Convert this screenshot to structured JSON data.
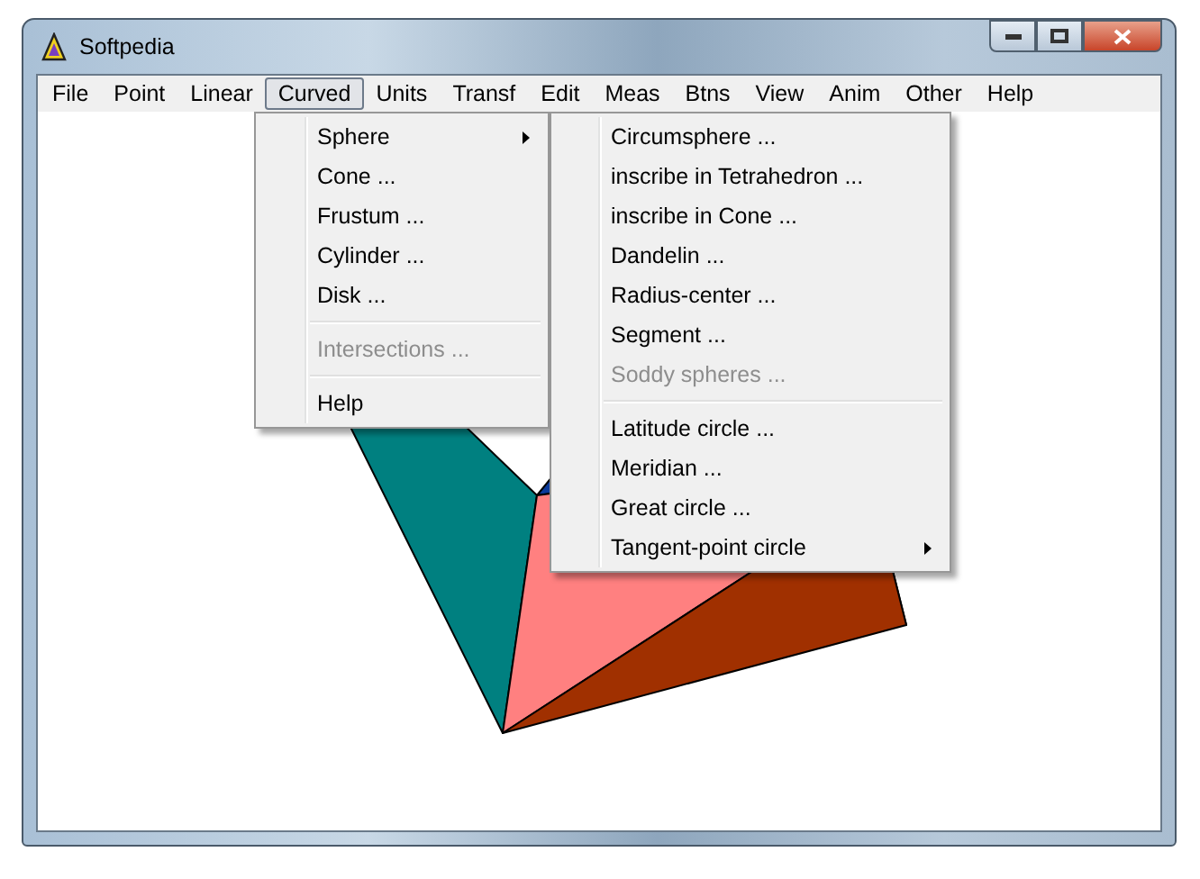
{
  "window": {
    "title": "Softpedia"
  },
  "menu_bar": [
    {
      "label": "File",
      "selected": false
    },
    {
      "label": "Point",
      "selected": false
    },
    {
      "label": "Linear",
      "selected": false
    },
    {
      "label": "Curved",
      "selected": true
    },
    {
      "label": "Units",
      "selected": false
    },
    {
      "label": "Transf",
      "selected": false
    },
    {
      "label": "Edit",
      "selected": false
    },
    {
      "label": "Meas",
      "selected": false
    },
    {
      "label": "Btns",
      "selected": false
    },
    {
      "label": "View",
      "selected": false
    },
    {
      "label": "Anim",
      "selected": false
    },
    {
      "label": "Other",
      "selected": false
    },
    {
      "label": "Help",
      "selected": false
    }
  ],
  "dropdown": [
    {
      "kind": "item",
      "label": "Sphere",
      "disabled": false,
      "submenu": true
    },
    {
      "kind": "item",
      "label": "Cone ...",
      "disabled": false,
      "submenu": false
    },
    {
      "kind": "item",
      "label": "Frustum ...",
      "disabled": false,
      "submenu": false
    },
    {
      "kind": "item",
      "label": "Cylinder ...",
      "disabled": false,
      "submenu": false
    },
    {
      "kind": "item",
      "label": "Disk ...",
      "disabled": false,
      "submenu": false
    },
    {
      "kind": "separator"
    },
    {
      "kind": "item",
      "label": "Intersections ...",
      "disabled": true,
      "submenu": false
    },
    {
      "kind": "separator"
    },
    {
      "kind": "item",
      "label": "Help",
      "disabled": false,
      "submenu": false
    }
  ],
  "submenu": [
    {
      "kind": "item",
      "label": "Circumsphere ...",
      "disabled": false,
      "submenu": false
    },
    {
      "kind": "item",
      "label": "inscribe in Tetrahedron ...",
      "disabled": false,
      "submenu": false
    },
    {
      "kind": "item",
      "label": "inscribe in Cone ...",
      "disabled": false,
      "submenu": false
    },
    {
      "kind": "item",
      "label": "Dandelin ...",
      "disabled": false,
      "submenu": false
    },
    {
      "kind": "item",
      "label": "Radius-center ...",
      "disabled": false,
      "submenu": false
    },
    {
      "kind": "item",
      "label": "Segment ...",
      "disabled": false,
      "submenu": false
    },
    {
      "kind": "item",
      "label": "Soddy spheres ...",
      "disabled": true,
      "submenu": false
    },
    {
      "kind": "separator"
    },
    {
      "kind": "item",
      "label": "Latitude circle ...",
      "disabled": false,
      "submenu": false
    },
    {
      "kind": "item",
      "label": "Meridian ...",
      "disabled": false,
      "submenu": false
    },
    {
      "kind": "item",
      "label": "Great circle ...",
      "disabled": false,
      "submenu": false
    },
    {
      "kind": "item",
      "label": "Tangent-point circle",
      "disabled": false,
      "submenu": true
    }
  ]
}
